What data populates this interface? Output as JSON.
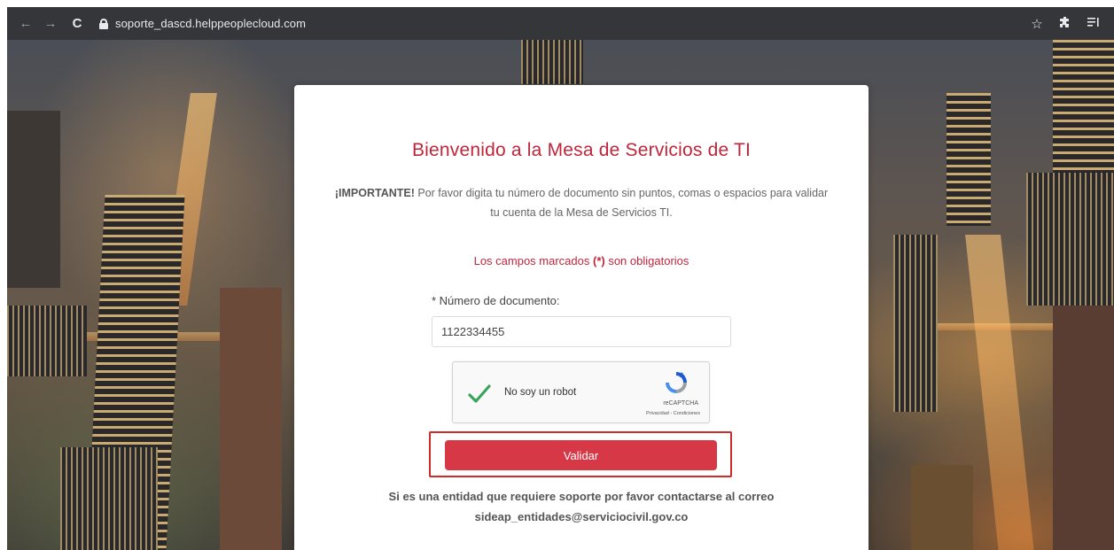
{
  "browser": {
    "url": "soporte_dascd.helppeoplecloud.com",
    "icons": [
      "back-arrow-icon",
      "forward-arrow-icon",
      "reload-icon",
      "lock-icon",
      "star-icon",
      "extensions-icon",
      "reading-list-icon"
    ]
  },
  "card": {
    "title": "Bienvenido a la Mesa de Servicios de TI",
    "important_strong": "¡IMPORTANTE!",
    "important_text": " Por favor digita tu número de documento sin puntos, comas o espacios para validar tu cuenta de la Mesa de Servicios TI.",
    "required_prefix": "Los campos marcados ",
    "required_mark": "(*)",
    "required_suffix": " son obligatorios",
    "doc_label": "* Número de documento:",
    "doc_value": "1122334455",
    "captcha": {
      "label": "No soy un robot",
      "brand": "reCAPTCHA",
      "links": "Privacidad - Condiciones"
    },
    "validate_label": "Validar",
    "footer_line1": "Si es una entidad que requiere soporte por favor contactarse al correo",
    "footer_line2": "sideap_entidades@serviciocivil.gov.co"
  },
  "colors": {
    "accent": "#c0263b",
    "button": "#d73846",
    "highlight": "#d02b2b",
    "chrome": "#35363a"
  }
}
